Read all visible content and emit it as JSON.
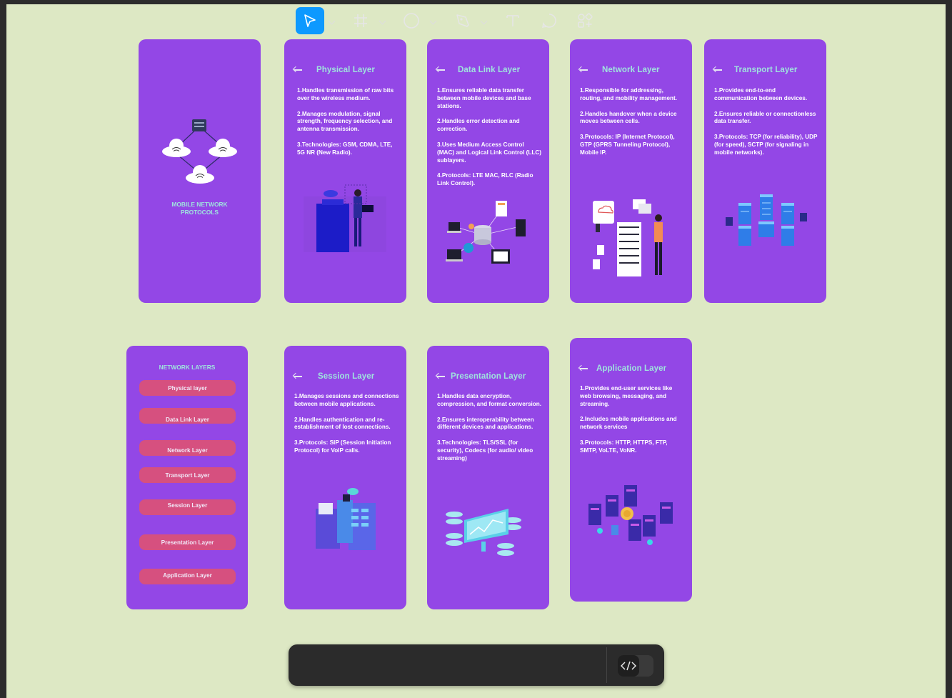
{
  "cover": {
    "title_line1": "MOBILE NETWORK",
    "title_line2": "PROTOCOLS"
  },
  "cards": {
    "physical": {
      "title": "Physical Layer",
      "points": [
        "1.Handles transmission of raw bits over the wireless medium.",
        "2.Manages modulation, signal strength, frequency selection, and antenna transmission.",
        "3.Technologies: GSM, CDMA, LTE, 5G NR (New Radio)."
      ]
    },
    "datalink": {
      "title": "Data Link Layer",
      "points": [
        "1.Ensures reliable data transfer between mobile devices and base stations.",
        "2.Handles error detection and correction.",
        "3.Uses Medium Access Control (MAC) and Logical Link Control (LLC) sublayers.",
        "4.Protocols: LTE MAC, RLC (Radio Link Control)."
      ]
    },
    "network": {
      "title": "Network Layer",
      "points": [
        "1.Responsible for addressing, routing, and mobility management.",
        "2.Handles handover when a device moves between cells.",
        "3.Protocols: IP (Internet Protocol), GTP (GPRS Tunneling Protocol), Mobile IP."
      ]
    },
    "transport": {
      "title": "Transport Layer",
      "points": [
        "1.Provides end-to-end communication between devices.",
        "2.Ensures reliable or connectionless data transfer.",
        "3.Protocols: TCP (for reliability), UDP (for speed), SCTP (for signaling in mobile networks)."
      ]
    },
    "session": {
      "title": "Session Layer",
      "points": [
        "1.Manages sessions and connections between mobile applications.",
        "2.Handles authentication and re-establishment of lost connections.",
        "3.Protocols: SIP (Session Initiation Protocol) for VoIP calls."
      ]
    },
    "presentation": {
      "title": "Presentation Layer",
      "points": [
        "1.Handles data encryption, compression, and format conversion.",
        "2.Ensures interoperability between different devices and applications.",
        "3.Technologies: TLS/SSL (for security), Codecs (for audio/ video streaming)"
      ]
    },
    "application": {
      "title": "Application Layer",
      "points": [
        "1.Provides end-user services like web browsing, messaging, and streaming.",
        "2.Includes mobile applications and network services",
        "3.Protocols: HTTP, HTTPS, FTP, SMTP, VoLTE, VoNR."
      ]
    }
  },
  "menu": {
    "title": "NETWORK LAYERS",
    "items": [
      "Physical layer",
      "Data Link Layer",
      "Network Layer",
      "Transport Layer",
      "Session Layer",
      "Presentation Layer",
      "Application Layer"
    ]
  },
  "toolbar": {
    "tools": [
      "move-tool",
      "frame-tool",
      "ellipse-tool",
      "pen-tool",
      "text-tool",
      "comment-tool",
      "components-tool",
      "dev-mode-toggle"
    ]
  },
  "colors": {
    "canvas": "#dde8c4",
    "card": "#9347e6",
    "title": "#9fe3de",
    "pill": "#d6507f",
    "active_tool": "#0d99ff"
  }
}
